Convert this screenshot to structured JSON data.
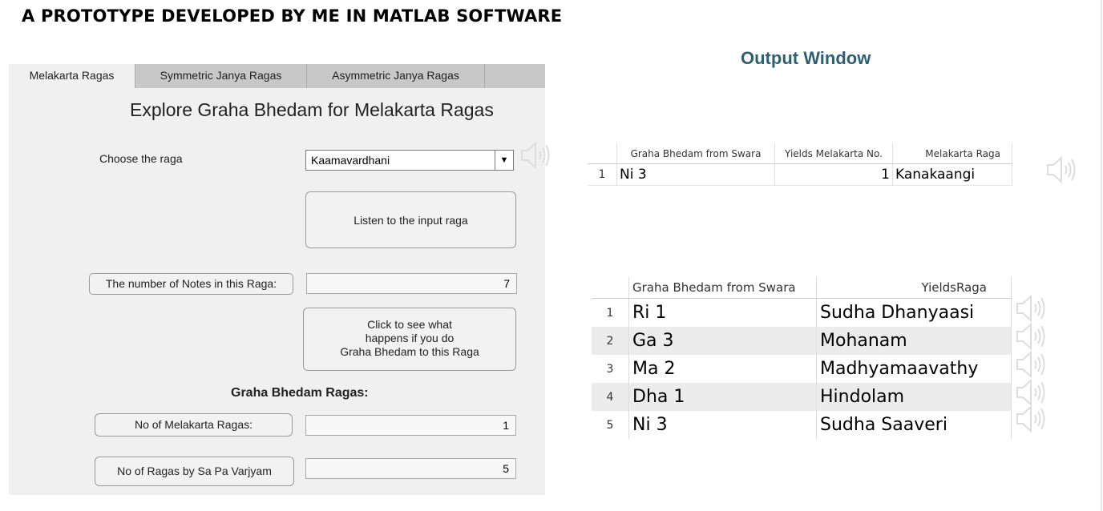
{
  "page_title": "A PROTOTYPE DEVELOPED BY ME IN MATLAB SOFTWARE",
  "tabs": [
    {
      "label": "Melakarta Ragas"
    },
    {
      "label": "Symmetric Janya Ragas"
    },
    {
      "label": "Asymmetric Janya Ragas"
    }
  ],
  "main": {
    "heading": "Explore Graha Bhedam for Melakarta Ragas",
    "choose_label": "Choose the raga",
    "raga_select_value": "Kaamavardhani",
    "listen_button": "Listen to the input raga",
    "notes_label": "The number of Notes in this Raga:",
    "notes_value": "7",
    "graha_button_lines": [
      "Click to see what",
      "happens if you do",
      "Graha Bhedam to this Raga"
    ],
    "graha_section_title": "Graha Bhedam Ragas:",
    "melakarta_count_label": "No of Melakarta Ragas:",
    "melakarta_count_value": "1",
    "sapa_count_label": "No of Ragas by Sa Pa Varjyam",
    "sapa_count_value": "5"
  },
  "output": {
    "title": "Output Window",
    "table1": {
      "headers": [
        "Graha Bhedam from Swara",
        "Yields Melakarta No.",
        "Melakarta Raga"
      ],
      "rows": [
        {
          "n": "1",
          "swara": "Ni 3",
          "no": "1",
          "raga": "Kanakaangi"
        }
      ]
    },
    "table2": {
      "headers": [
        "Graha Bhedam from Swara",
        "YieldsRaga"
      ],
      "rows": [
        {
          "n": "1",
          "swara": "Ri 1",
          "raga": "Sudha Dhanyaasi"
        },
        {
          "n": "2",
          "swara": "Ga 3",
          "raga": "Mohanam"
        },
        {
          "n": "3",
          "swara": "Ma 2",
          "raga": "Madhyamaavathy"
        },
        {
          "n": "4",
          "swara": "Dha 1",
          "raga": "Hindolam"
        },
        {
          "n": "5",
          "swara": "Ni 3",
          "raga": "Sudha Saaveri"
        }
      ]
    }
  },
  "colors": {
    "output_title": "#2e5f73",
    "panel_bg": "#f0f0f0",
    "tab_strip": "#c8c8c8"
  },
  "icons": {
    "play": "speaker-icon",
    "dropdown": "chevron-down-icon"
  }
}
